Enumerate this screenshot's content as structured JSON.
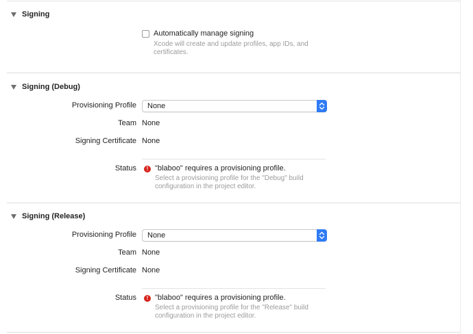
{
  "signing": {
    "title": "Signing",
    "auto_manage_label": "Automatically manage signing",
    "auto_manage_checked": false,
    "auto_manage_hint_line1": "Xcode will create and update profiles, app IDs, and",
    "auto_manage_hint_line2": "certificates."
  },
  "debug": {
    "title": "Signing (Debug)",
    "provisioning_label": "Provisioning Profile",
    "provisioning_value": "None",
    "team_label": "Team",
    "team_value": "None",
    "certificate_label": "Signing Certificate",
    "certificate_value": "None",
    "status_label": "Status",
    "status_message": "\"blaboo\" requires a provisioning profile.",
    "status_hint_line1": "Select a provisioning profile for the \"Debug\" build",
    "status_hint_line2": "configuration in the project editor."
  },
  "release": {
    "title": "Signing (Release)",
    "provisioning_label": "Provisioning Profile",
    "provisioning_value": "None",
    "team_label": "Team",
    "team_value": "None",
    "certificate_label": "Signing Certificate",
    "certificate_value": "None",
    "status_label": "Status",
    "status_message": "\"blaboo\" requires a provisioning profile.",
    "status_hint_line1": "Select a provisioning profile for the \"Release\" build",
    "status_hint_line2": "configuration in the project editor."
  },
  "colors": {
    "accent": "#2f7bf5",
    "error": "#d6231c",
    "hint_text": "#9b9b9b",
    "separator": "#dddddd"
  },
  "icons": {
    "disclosure": "disclosure-triangle-icon",
    "error": "error-icon",
    "popup": "popup-arrows-icon"
  }
}
